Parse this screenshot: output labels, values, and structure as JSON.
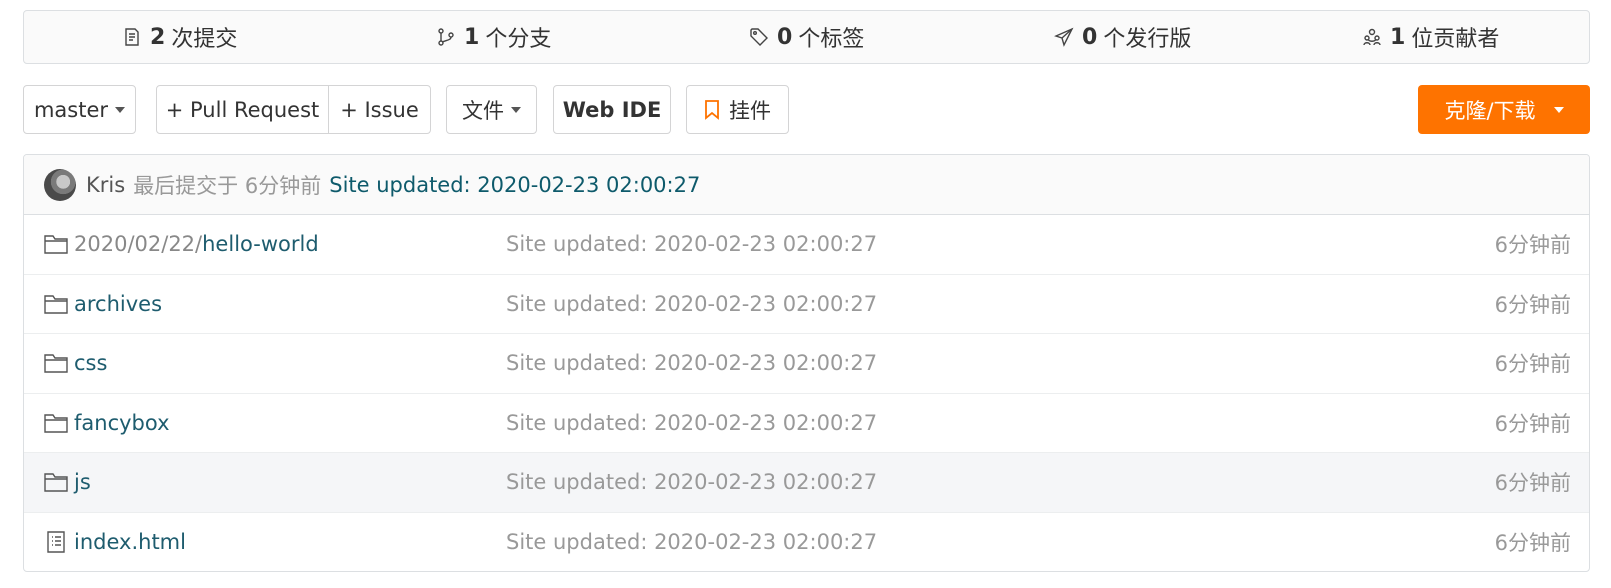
{
  "stats": [
    {
      "num": "2",
      "label": "次提交",
      "icon": "commit-icon"
    },
    {
      "num": "1",
      "label": "个分支",
      "icon": "branch-icon"
    },
    {
      "num": "0",
      "label": "个标签",
      "icon": "tag-icon"
    },
    {
      "num": "0",
      "label": "个发行版",
      "icon": "release-icon"
    },
    {
      "num": "1",
      "label": "位贡献者",
      "icon": "contributors-icon"
    }
  ],
  "toolbar": {
    "branch": "master",
    "pull_request": "+ Pull Request",
    "issue": "+ Issue",
    "files": "文件",
    "web_ide": "Web IDE",
    "plugin": "挂件",
    "clone": "克隆/下载"
  },
  "commit": {
    "author": "Kris",
    "meta": "最后提交于 6分钟前",
    "message": "Site updated: 2020-02-23 02:00:27"
  },
  "files": [
    {
      "type": "folder",
      "prefix": "2020/02/22/",
      "name": "hello-world",
      "message": "Site updated: 2020-02-23 02:00:27",
      "time": "6分钟前"
    },
    {
      "type": "folder",
      "prefix": "",
      "name": "archives",
      "message": "Site updated: 2020-02-23 02:00:27",
      "time": "6分钟前"
    },
    {
      "type": "folder",
      "prefix": "",
      "name": "css",
      "message": "Site updated: 2020-02-23 02:00:27",
      "time": "6分钟前"
    },
    {
      "type": "folder",
      "prefix": "",
      "name": "fancybox",
      "message": "Site updated: 2020-02-23 02:00:27",
      "time": "6分钟前"
    },
    {
      "type": "folder",
      "prefix": "",
      "name": "js",
      "message": "Site updated: 2020-02-23 02:00:27",
      "time": "6分钟前"
    },
    {
      "type": "file",
      "prefix": "",
      "name": "index.html",
      "message": "Site updated: 2020-02-23 02:00:27",
      "time": "6分钟前"
    }
  ],
  "colors": {
    "accent": "#fe7300",
    "link": "#1e5c6e",
    "muted": "#999999"
  }
}
